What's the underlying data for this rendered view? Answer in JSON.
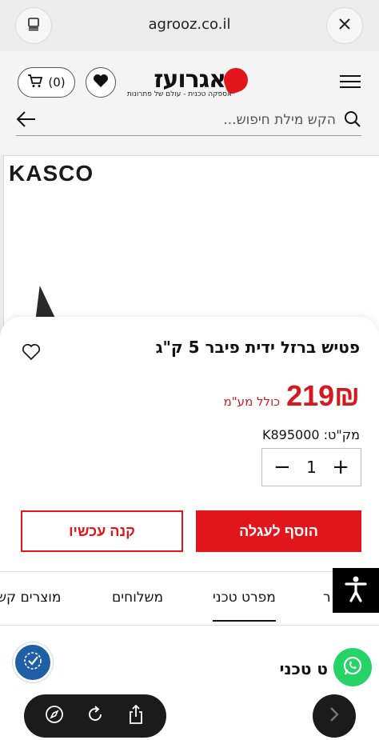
{
  "browser": {
    "url": "agrooz.co.il"
  },
  "header": {
    "cart_count": "(0)",
    "logo_name": "אגרועז",
    "logo_tagline": "אספקה טכנית - עולם של פתרונות",
    "search_placeholder": "הקש מילת חיפוש..."
  },
  "product": {
    "brand_logo": "KASCO",
    "title": "פטיש ברזל ידית פיבר 5 ק\"ג",
    "price": "219₪",
    "vat_note": "כולל מע\"מ",
    "sku": "מק\"ט: K895000",
    "quantity": "1",
    "qty_minus": "−",
    "qty_plus": "+",
    "add_to_cart": "הוסף לעגלה",
    "buy_now": "קנה עכשיו"
  },
  "tabs": [
    {
      "label": "ר"
    },
    {
      "label": "מפרט טכני"
    },
    {
      "label": "משלוחים"
    },
    {
      "label": "מוצרים קש"
    }
  ],
  "section": {
    "title": "ט טכני"
  },
  "colors": {
    "accent_red": "#e3151c",
    "price_red": "#d51a1f",
    "whatsapp_green": "#25d366",
    "accessibility_bg": "#000000"
  },
  "icons": {
    "tabs": "tab-overview-icon",
    "close": "close-icon",
    "cart": "cart-icon",
    "wishlist": "heart-icon",
    "menu": "hamburger-icon",
    "search": "search-icon",
    "back": "arrow-left-icon",
    "favorite": "heart-outline-icon",
    "accessibility": "accessibility-icon",
    "whatsapp": "whatsapp-icon",
    "compass": "compass-icon",
    "reload": "reload-icon",
    "share": "share-icon",
    "forward": "chevron-right-icon"
  }
}
